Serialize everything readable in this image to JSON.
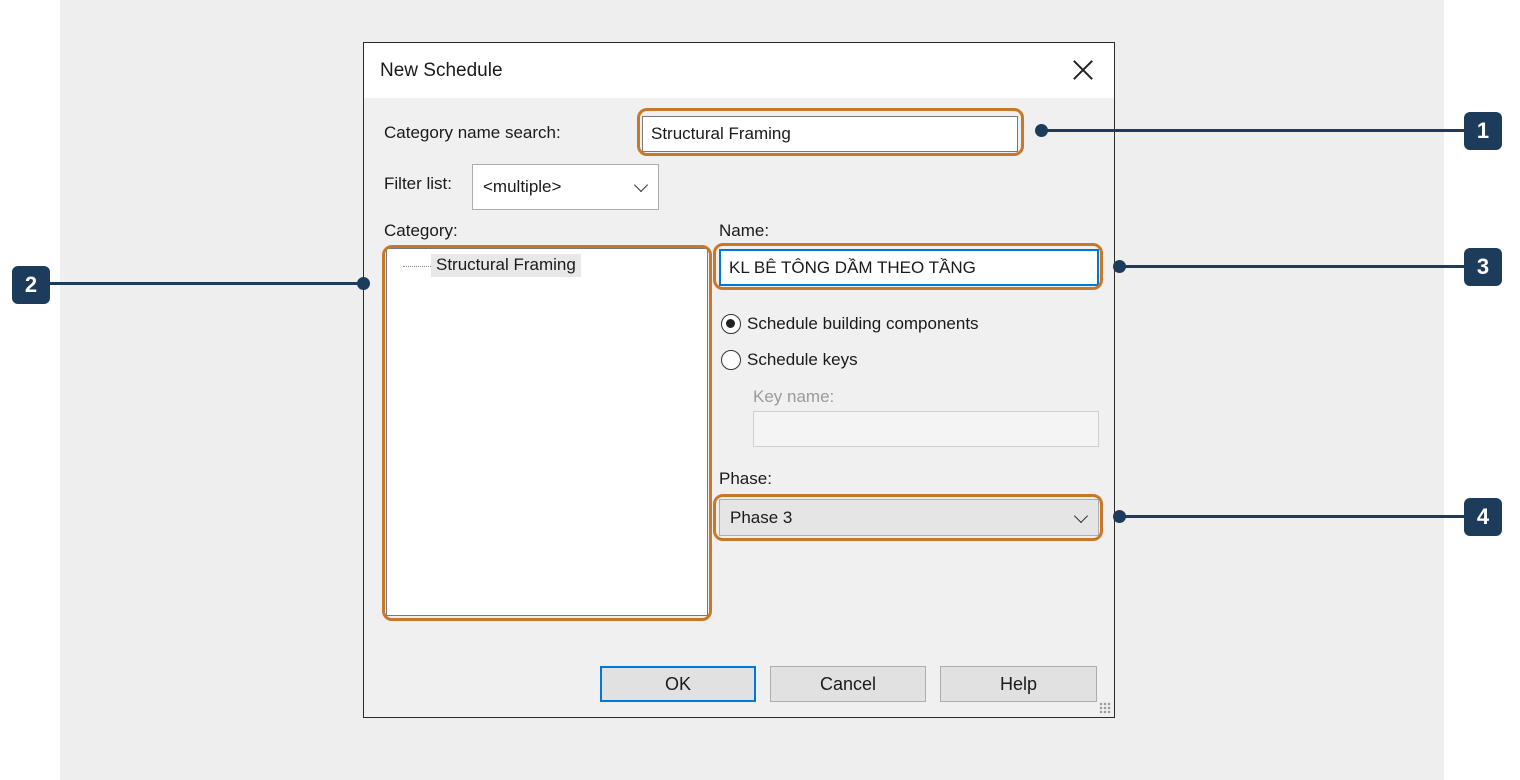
{
  "dialog": {
    "title": "New Schedule",
    "category_search_label": "Category name search:",
    "category_search_value": "Structural Framing",
    "filter_label": "Filter list:",
    "filter_value": "<multiple>",
    "category_label": "Category:",
    "category_items": [
      "Structural Framing"
    ],
    "name_label": "Name:",
    "name_value": "KL BÊ TÔNG DẦM THEO TẦNG",
    "radio_components": "Schedule building components",
    "radio_keys": "Schedule keys",
    "radio_selected": "Schedule building components",
    "key_name_label": "Key name:",
    "key_name_value": "",
    "phase_label": "Phase:",
    "phase_value": "Phase 3",
    "ok_label": "OK",
    "cancel_label": "Cancel",
    "help_label": "Help"
  },
  "callouts": [
    "1",
    "2",
    "3",
    "4"
  ],
  "colors": {
    "highlight": "#c8782b",
    "callout": "#1d3c5c",
    "focus": "#0078d7"
  }
}
